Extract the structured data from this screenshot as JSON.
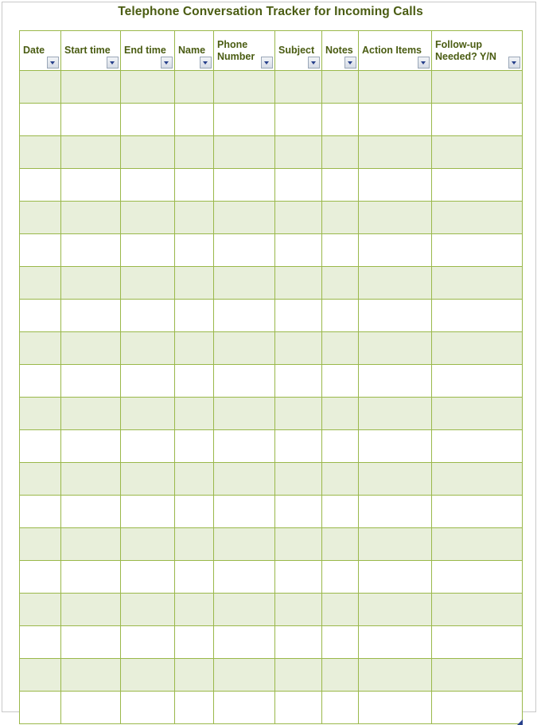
{
  "document": {
    "title": "Telephone Conversation Tracker for Incoming Calls"
  },
  "table": {
    "columns": [
      {
        "label": "Date",
        "filter_icon": "filter-dropdown-icon"
      },
      {
        "label": "Start time",
        "filter_icon": "filter-dropdown-icon"
      },
      {
        "label": "End time",
        "filter_icon": "filter-dropdown-icon"
      },
      {
        "label": "Name",
        "filter_icon": "filter-dropdown-icon"
      },
      {
        "label": "Phone Number",
        "filter_icon": "filter-dropdown-icon"
      },
      {
        "label": "Subject",
        "filter_icon": "filter-dropdown-icon"
      },
      {
        "label": "Notes",
        "filter_icon": "filter-dropdown-icon"
      },
      {
        "label": "Action Items",
        "filter_icon": "filter-dropdown-icon"
      },
      {
        "label": "Follow-up Needed? Y/N",
        "filter_icon": "filter-dropdown-icon"
      }
    ],
    "row_count": 20,
    "rows": [
      [
        "",
        "",
        "",
        "",
        "",
        "",
        "",
        "",
        ""
      ],
      [
        "",
        "",
        "",
        "",
        "",
        "",
        "",
        "",
        ""
      ],
      [
        "",
        "",
        "",
        "",
        "",
        "",
        "",
        "",
        ""
      ],
      [
        "",
        "",
        "",
        "",
        "",
        "",
        "",
        "",
        ""
      ],
      [
        "",
        "",
        "",
        "",
        "",
        "",
        "",
        "",
        ""
      ],
      [
        "",
        "",
        "",
        "",
        "",
        "",
        "",
        "",
        ""
      ],
      [
        "",
        "",
        "",
        "",
        "",
        "",
        "",
        "",
        ""
      ],
      [
        "",
        "",
        "",
        "",
        "",
        "",
        "",
        "",
        ""
      ],
      [
        "",
        "",
        "",
        "",
        "",
        "",
        "",
        "",
        ""
      ],
      [
        "",
        "",
        "",
        "",
        "",
        "",
        "",
        "",
        ""
      ],
      [
        "",
        "",
        "",
        "",
        "",
        "",
        "",
        "",
        ""
      ],
      [
        "",
        "",
        "",
        "",
        "",
        "",
        "",
        "",
        ""
      ],
      [
        "",
        "",
        "",
        "",
        "",
        "",
        "",
        "",
        ""
      ],
      [
        "",
        "",
        "",
        "",
        "",
        "",
        "",
        "",
        ""
      ],
      [
        "",
        "",
        "",
        "",
        "",
        "",
        "",
        "",
        ""
      ],
      [
        "",
        "",
        "",
        "",
        "",
        "",
        "",
        "",
        ""
      ],
      [
        "",
        "",
        "",
        "",
        "",
        "",
        "",
        "",
        ""
      ],
      [
        "",
        "",
        "",
        "",
        "",
        "",
        "",
        "",
        ""
      ],
      [
        "",
        "",
        "",
        "",
        "",
        "",
        "",
        "",
        ""
      ],
      [
        "",
        "",
        "",
        "",
        "",
        "",
        "",
        "",
        ""
      ]
    ]
  },
  "colors": {
    "title_text": "#4a5c12",
    "header_text": "#4a5c12",
    "grid_border": "#9ab84a",
    "row_shaded": "#e8efda",
    "row_plain": "#ffffff",
    "filter_button_caret": "#27408b",
    "page_frame": "#c9c9c9"
  }
}
